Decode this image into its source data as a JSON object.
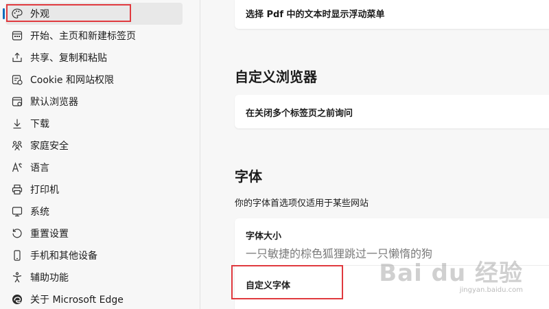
{
  "sidebar": {
    "items": [
      {
        "label": "外观",
        "icon": "palette-icon"
      },
      {
        "label": "开始、主页和新建标签页",
        "icon": "home-window-icon"
      },
      {
        "label": "共享、复制和粘贴",
        "icon": "share-icon"
      },
      {
        "label": "Cookie 和网站权限",
        "icon": "site-permissions-icon"
      },
      {
        "label": "默认浏览器",
        "icon": "browser-icon"
      },
      {
        "label": "下载",
        "icon": "download-icon"
      },
      {
        "label": "家庭安全",
        "icon": "family-icon"
      },
      {
        "label": "语言",
        "icon": "language-icon"
      },
      {
        "label": "打印机",
        "icon": "printer-icon"
      },
      {
        "label": "系统",
        "icon": "system-icon"
      },
      {
        "label": "重置设置",
        "icon": "reset-icon"
      },
      {
        "label": "手机和其他设备",
        "icon": "phone-icon"
      },
      {
        "label": "辅助功能",
        "icon": "accessibility-icon"
      },
      {
        "label": "关于 Microsoft Edge",
        "icon": "edge-logo-icon"
      }
    ],
    "active_index": 0
  },
  "main": {
    "pdf_menu_label": "选择 Pdf 中的文本时显示浮动菜单",
    "custom_browser": {
      "title": "自定义浏览器",
      "ask_before_close_label": "在关闭多个标签页之前询问"
    },
    "fonts": {
      "title": "字体",
      "description": "你的字体首选项仅适用于某些网站",
      "font_size_label": "字体大小",
      "font_size_sample": "一只敏捷的棕色狐狸跳过一只懒惰的狗",
      "custom_fonts_label": "自定义字体"
    }
  },
  "watermark": {
    "main": "Bai du 经验",
    "sub": "jingyan.baidu.com"
  },
  "colors": {
    "accent": "#0f6cbd",
    "highlight": "#e0393e"
  }
}
